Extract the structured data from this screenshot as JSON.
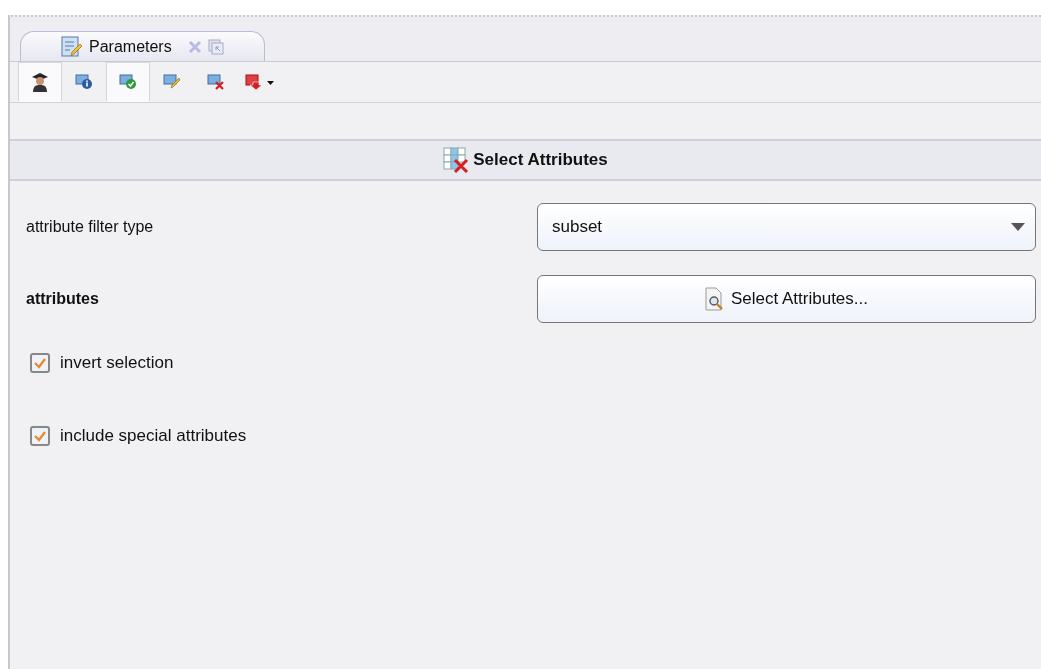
{
  "tab": {
    "label": "Parameters",
    "selected": true
  },
  "toolbar": [
    {
      "kind": "expert",
      "selected": true
    },
    {
      "kind": "info",
      "selected": false
    },
    {
      "kind": "check",
      "selected": true
    },
    {
      "kind": "edit",
      "selected": false
    },
    {
      "kind": "delete",
      "selected": false
    },
    {
      "kind": "export",
      "selected": false
    }
  ],
  "header": {
    "title": "Select Attributes"
  },
  "parameters": [
    {
      "kind": "dropdown",
      "label": "attribute filter type",
      "value": "subset"
    },
    {
      "kind": "button",
      "label": "attributes",
      "button_label": "Select Attributes..."
    },
    {
      "kind": "checkbox",
      "label": "invert selection",
      "checked": true
    },
    {
      "kind": "checkbox",
      "label": "include special attributes",
      "checked": true
    }
  ]
}
